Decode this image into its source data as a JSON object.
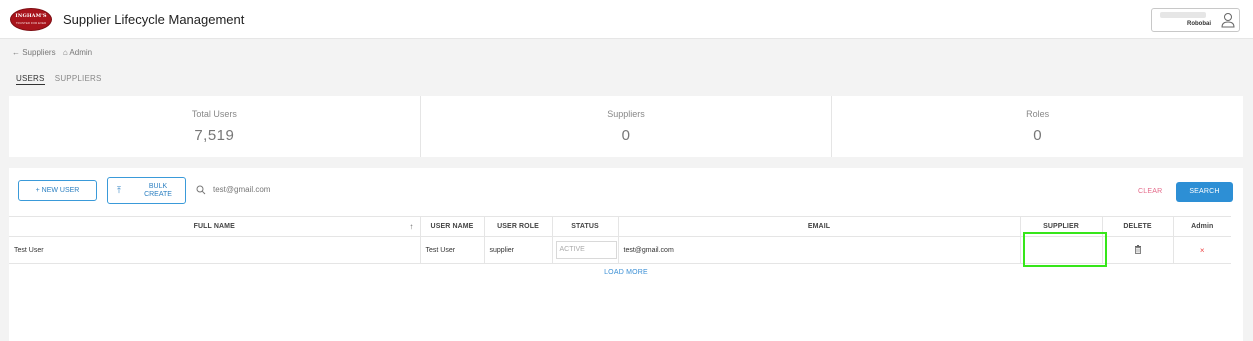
{
  "header": {
    "logo_text": "INGHAM'S",
    "logo_sub": "TRUSTED FOR EVER",
    "title": "Supplier Lifecycle Management",
    "user_label": "Robobai"
  },
  "breadcrumb": {
    "back": "← Suppliers",
    "home": "⌂ Admin"
  },
  "tabs": [
    {
      "label": "USERS",
      "active": true
    },
    {
      "label": "SUPPLIERS",
      "active": false
    }
  ],
  "stats": [
    {
      "label": "Total Users",
      "value": "7,519"
    },
    {
      "label": "Suppliers",
      "value": "0"
    },
    {
      "label": "Roles",
      "value": "0"
    }
  ],
  "toolbar": {
    "new_user": "+ NEW USER",
    "bulk_line1": "BULK",
    "bulk_line2": "CREATE",
    "bulk_icon": "upload-icon",
    "search_value": "test@gmail.com",
    "clear": "CLEAR",
    "search": "SEARCH"
  },
  "table": {
    "columns": [
      "FULL NAME",
      "USER NAME",
      "USER ROLE",
      "STATUS",
      "EMAIL",
      "SUPPLIER",
      "DELETE",
      "Admin"
    ],
    "rows": [
      {
        "full_name": "Test User",
        "user_name": "Test User",
        "user_role": "supplier",
        "status": "ACTIVE",
        "email": "test@gmail.com",
        "supplier": "",
        "delete_icon": "trash-icon",
        "admin": "×"
      }
    ]
  },
  "load_more": "LOAD MORE",
  "colors": {
    "accent": "#2d8fd5",
    "brand": "#a8141c",
    "clear": "#e46a8a",
    "highlight": "#36e61a"
  }
}
